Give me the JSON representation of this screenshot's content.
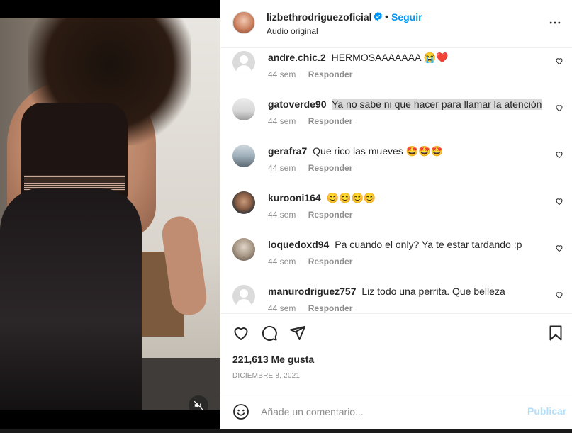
{
  "post": {
    "username": "lizbethrodriguezoficial",
    "separator": "•",
    "follow_label": "Seguir",
    "subtitle": "Audio original",
    "likes_text": "221,613 Me gusta",
    "date": "DICIEMBRE 8, 2021"
  },
  "comments": [
    {
      "user": "andre.chic.2",
      "text": "HERMOSAAAAAAA 😭❤️",
      "time": "44 sem",
      "reply": "Responder"
    },
    {
      "user": "gatoverde90",
      "text": "Ya no sabe ni que hacer para llamar la atención",
      "time": "44 sem",
      "reply": "Responder"
    },
    {
      "user": "gerafra7",
      "text": "Que rico las mueves 🤩🤩🤩",
      "time": "44 sem",
      "reply": "Responder"
    },
    {
      "user": "kurooni164",
      "text": "😊😊😊😊",
      "time": "44 sem",
      "reply": "Responder"
    },
    {
      "user": "loquedoxd94",
      "text": "Pa cuando el only? Ya te estar tardando :p",
      "time": "44 sem",
      "reply": "Responder"
    },
    {
      "user": "manurodriguez757",
      "text": "Liz todo una perrita. Que belleza",
      "time": "44 sem",
      "reply": "Responder"
    }
  ],
  "composer": {
    "placeholder": "Añade un comentario...",
    "publish_label": "Publicar"
  },
  "colors": {
    "accent": "#0095f6",
    "publish_disabled": "#b2dffc",
    "muted_text": "#8e8e8e",
    "highlight": "#d9d9d9"
  },
  "icons": [
    "verified-icon",
    "more-options-icon",
    "heart-icon",
    "comment-icon",
    "share-icon",
    "save-icon",
    "emoji-icon",
    "mute-icon"
  ]
}
